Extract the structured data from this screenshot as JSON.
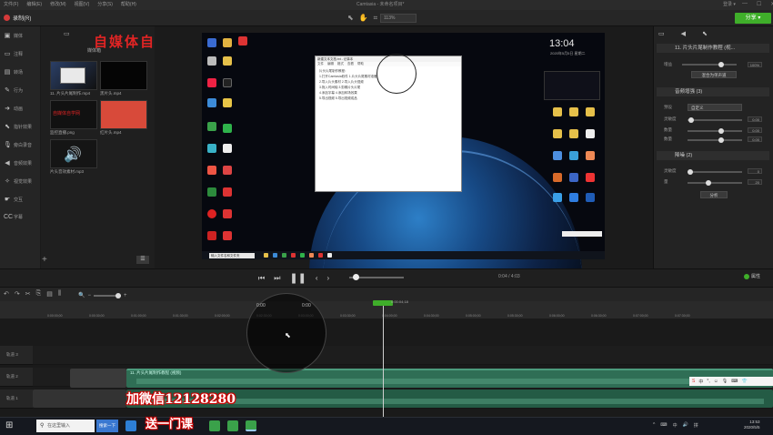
{
  "window": {
    "menu": [
      "文件(F)",
      "编辑(E)",
      "修改(M)",
      "视图(V)",
      "分享(S)",
      "帮助(H)"
    ],
    "title": "Camtasia - 未命名项目*",
    "user": "登录 ▾",
    "controls": [
      "—",
      "☐",
      "✕"
    ]
  },
  "toolbar": {
    "record_label": "录制(R)",
    "zoom_value": "113%",
    "share_label": "分享 ▾"
  },
  "nav": {
    "items": [
      {
        "label": "媒体",
        "icon": "▣"
      },
      {
        "label": "注释",
        "icon": "▭"
      },
      {
        "label": "转场",
        "icon": "▤"
      },
      {
        "label": "行为",
        "icon": "✎"
      },
      {
        "label": "动画",
        "icon": "➜"
      },
      {
        "label": "指针效果",
        "icon": "⬉"
      },
      {
        "label": "旁白录音",
        "icon": "🎙"
      },
      {
        "label": "音频效果",
        "icon": "◀"
      },
      {
        "label": "视觉效果",
        "icon": "✧"
      },
      {
        "label": "交互",
        "icon": "☛"
      },
      {
        "label": "字幕",
        "icon": "CC"
      }
    ]
  },
  "bin": {
    "tab_label": "媒体箱",
    "watermark_title": "自媒体自学网",
    "items": [
      {
        "label": "11. 片头片尾制作.mp4"
      },
      {
        "label": "黑片头.mp4"
      },
      {
        "label": "监控直播.png"
      },
      {
        "label": "红片头.mp4"
      },
      {
        "label": "片头音效素材.mp3"
      }
    ],
    "red_thumb_text": "自媒体自学网"
  },
  "canvas": {
    "clock": "13:04",
    "clock_date": "2020年5月5日 星期二",
    "doc_title": "新建文本文档.txt - 记事本",
    "doc_menu": [
      "文件",
      "编辑",
      "格式",
      "查看",
      "帮助"
    ],
    "doc_lines": [
      "片头片尾制作教程：",
      "1.打开Camtasia软件    1.片头片尾素材准备",
      "2.导入片头素材    2.导入片头视频",
      "3.拖入时间轴    3.剪辑片头片尾",
      "4.添加字幕    4.添加转场效果",
      "5.导出视频    5.导出视频成品"
    ],
    "start_popup": "输入文件名和文件夹"
  },
  "props": {
    "header1": "11. 片头片尾制作教程 (视...",
    "volume_label": "增益",
    "volume_value": "100%",
    "mix_button": "混合为单声道",
    "section2": "音频增强 (3)",
    "preset_label": "预设",
    "preset_value": "自定义",
    "reduce_label": "灵敏度",
    "reduce_value": "0.00",
    "amount_label": "数量",
    "amount_value": "0.00",
    "section3": "降噪 (2)",
    "sens_label": "灵敏度",
    "sens_value": "0",
    "amt_label": "量",
    "amt_value": "20",
    "analyze_button": "分析"
  },
  "playback": {
    "timecode": "0:04 / 4:03",
    "properties_label": "属性"
  },
  "timeline": {
    "ruler_ticks": [
      "0:00:00;00",
      "0:00:30;00",
      "0:01:00;00",
      "0:01:30;00",
      "0:02:00;00",
      "0:02:30;00",
      "0:03:00;00",
      "0:03:30;00",
      "0:04:00;00",
      "0:04:30;00",
      "0:05:00;00",
      "0:05:30;00",
      "0:06:00;00",
      "0:06:30;00",
      "0:07:00;00",
      "0:07:30;00"
    ],
    "playhead_time": "0:00:04;18",
    "ring_labels": [
      "0:00",
      "0:00"
    ],
    "tracks": [
      "轨道 3",
      "轨道 2",
      "轨道 1"
    ],
    "main_clip": "11. 片头片尾制作教程 (视频)"
  },
  "watermarks": {
    "wechat": "加微信12128280",
    "lesson": "送一门课"
  },
  "taskbar": {
    "search_placeholder": "在这里输入",
    "search_button": "搜索一下",
    "tray": [
      "^",
      "⌨",
      "中",
      "🔊",
      "拼"
    ],
    "time": "13:53",
    "date": "2020/5/5"
  }
}
